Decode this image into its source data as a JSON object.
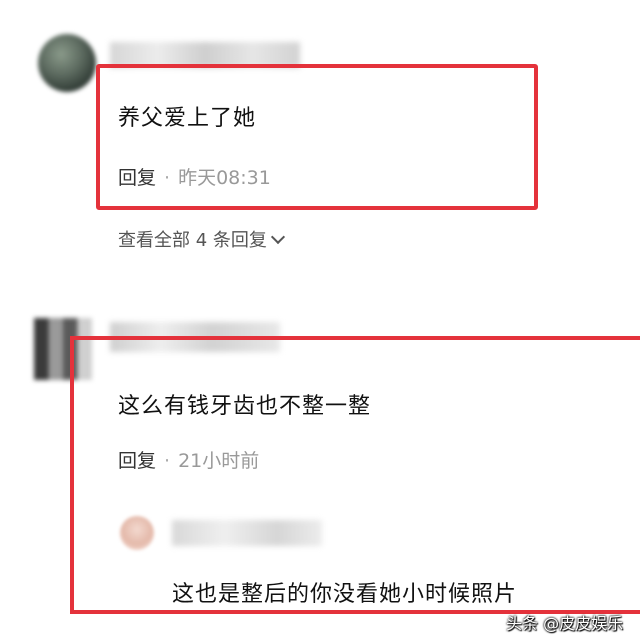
{
  "comment1": {
    "text": "养父爱上了她",
    "reply_label": "回复",
    "separator": "·",
    "time": "昨天08:31",
    "view_replies": "查看全部 4 条回复"
  },
  "comment2": {
    "text": "这么有钱牙齿也不整一整",
    "reply_label": "回复",
    "separator": "·",
    "time": "21小时前"
  },
  "reply": {
    "text": "这也是整后的你没看她小时候照片"
  },
  "watermark": "头条 @皮皮娱乐",
  "colors": {
    "highlight": "#e4323b",
    "meta": "#999999"
  }
}
